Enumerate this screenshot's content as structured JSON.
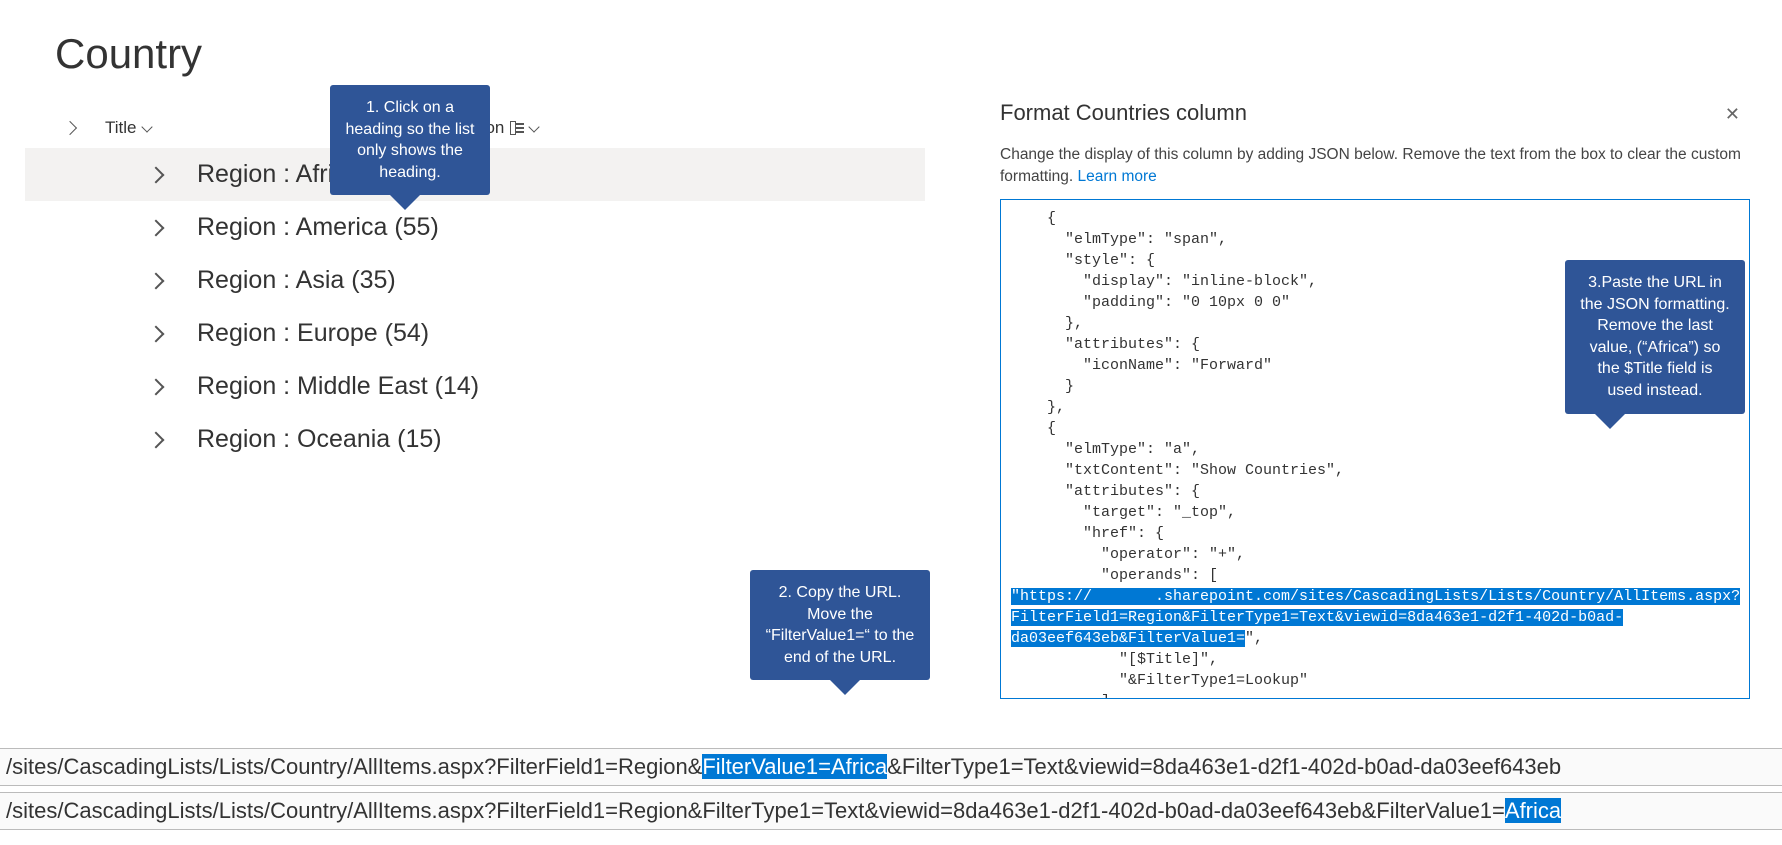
{
  "page_title": "Country",
  "columns": {
    "title": "Title",
    "region": "Region"
  },
  "groups": [
    {
      "label": "Region : Africa (58)",
      "selected": true
    },
    {
      "label": "Region : America (55)",
      "selected": false
    },
    {
      "label": "Region : Asia (35)",
      "selected": false
    },
    {
      "label": "Region : Europe (54)",
      "selected": false
    },
    {
      "label": "Region : Middle East (14)",
      "selected": false
    },
    {
      "label": "Region : Oceania (15)",
      "selected": false
    }
  ],
  "callouts": {
    "c1": "1. Click on a heading so the list only shows the heading.",
    "c2": "2. Copy the URL. Move the “FilterValue1=“ to the end of the URL.",
    "c3": "3.Paste the URL in the JSON formatting. Remove the last value, (“Africa”) so the $Title field is used instead."
  },
  "panel": {
    "title": "Format Countries column",
    "desc": "Change the display of this column by adding JSON below. Remove the text from the box to clear the custom formatting. ",
    "learn": "Learn more"
  },
  "json_lines": {
    "l1": "    {",
    "l2": "      \"elmType\": \"span\",",
    "l3": "      \"style\": {",
    "l4": "        \"display\": \"inline-block\",",
    "l5": "        \"padding\": \"0 10px 0 0\"",
    "l6": "      },",
    "l7": "      \"attributes\": {",
    "l8": "        \"iconName\": \"Forward\"",
    "l9": "      }",
    "l10": "    },",
    "l11": "    {",
    "l12": "      \"elmType\": \"a\",",
    "l13": "      \"txtContent\": \"Show Countries\",",
    "l14": "      \"attributes\": {",
    "l15": "        \"target\": \"_top\",",
    "l16": "        \"href\": {",
    "l17": "          \"operator\": \"+\",",
    "l18": "          \"operands\": [",
    "hl1": "\"https://       .sharepoint.com/sites/CascadingLists/Lists/Country/AllItems.aspx?",
    "hl2": "FilterField1=Region&FilterType1=Text&viewid=8da463e1-d2f1-402d-b0ad-",
    "hl3": "da03eef643eb&FilterValue1=",
    "l19": "\",",
    "l20": "            \"[$Title]\",",
    "l21": "            \"&FilterType1=Lookup\"",
    "l22": "          ]",
    "l23": "        }",
    "l24": "      }",
    "l25": "    }",
    "l26": "  ]",
    "l27": "}"
  },
  "url1": {
    "pre": "/sites/CascadingLists/Lists/Country/AllItems.aspx?FilterField1=Region&",
    "hl": "FilterValue1=Africa",
    "post": "&FilterType1=Text&viewid=8da463e1-d2f1-402d-b0ad-da03eef643eb"
  },
  "url2": {
    "pre": "/sites/CascadingLists/Lists/Country/AllItems.aspx?FilterField1=Region&FilterType1=Text&viewid=8da463e1-d2f1-402d-b0ad-da03eef643eb&FilterValue1=",
    "hl": "Africa"
  }
}
